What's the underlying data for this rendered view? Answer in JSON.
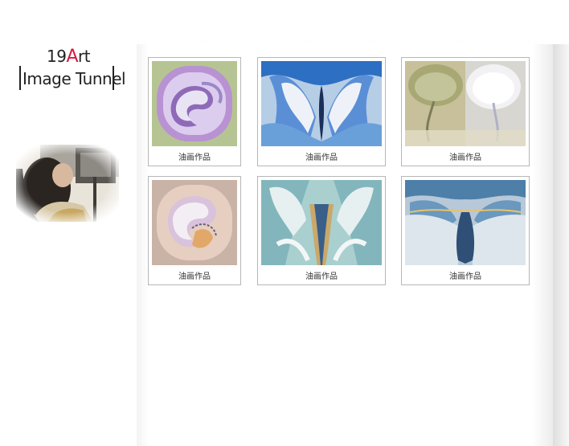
{
  "logo": {
    "line1_prefix": "19",
    "line1_accent": "A",
    "line1_suffix": "rt",
    "line2": "Image Tunnel"
  },
  "colors": {
    "accent": "#d6173c",
    "card_border": "#b7b7b7"
  },
  "gallery": {
    "items": [
      {
        "caption": "油画作品"
      },
      {
        "caption": "油画作品"
      },
      {
        "caption": "油画作品"
      },
      {
        "caption": "油画作品"
      },
      {
        "caption": "油画作品"
      },
      {
        "caption": "油画作品"
      }
    ]
  }
}
